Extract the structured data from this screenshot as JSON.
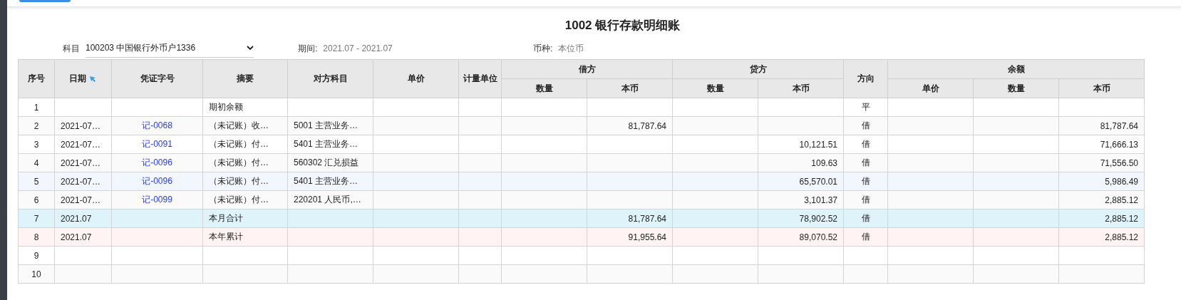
{
  "top_button": {
    "visible": true
  },
  "title": "1002 银行存款明细账",
  "filters": [
    {
      "kind": "select",
      "label": "科目",
      "value": "100203 中国银行外币户1336"
    },
    {
      "kind": "text",
      "label": "期间:",
      "value": "2021.07 - 2021.07"
    },
    {
      "kind": "text",
      "label": "币种:",
      "value": "本位币"
    }
  ],
  "table": {
    "header_rows": [
      [
        {
          "label": "序号",
          "rowspan": 2,
          "sortable": false
        },
        {
          "label": "日期",
          "rowspan": 2,
          "sortable": true
        },
        {
          "label": "凭证字号",
          "rowspan": 2,
          "sortable": false
        },
        {
          "label": "摘要",
          "rowspan": 2,
          "sortable": false
        },
        {
          "label": "对方科目",
          "rowspan": 2,
          "sortable": false
        },
        {
          "label": "单价",
          "rowspan": 2,
          "sortable": false
        },
        {
          "label": "计量单位",
          "rowspan": 2,
          "sortable": false
        },
        {
          "label": "借方",
          "colspan": 2,
          "sortable": false
        },
        {
          "label": "贷方",
          "colspan": 2,
          "sortable": false
        },
        {
          "label": "方向",
          "rowspan": 2,
          "sortable": false
        },
        {
          "label": "余额",
          "colspan": 3,
          "sortable": false
        }
      ],
      [
        {
          "label": "数量",
          "sortable": false
        },
        {
          "label": "本币",
          "sortable": false
        },
        {
          "label": "数量",
          "sortable": false
        },
        {
          "label": "本币",
          "sortable": false
        },
        {
          "label": "单价",
          "sortable": false
        },
        {
          "label": "数量",
          "sortable": false
        },
        {
          "label": "本币",
          "sortable": false
        }
      ]
    ],
    "rows": [
      {
        "kind": "normal",
        "selected": false,
        "cells": [
          "1",
          "",
          "",
          "期初余额",
          "",
          "",
          "",
          "",
          "",
          "",
          "",
          "平",
          "",
          "",
          ""
        ]
      },
      {
        "kind": "normal",
        "selected": false,
        "cells": [
          "2",
          "2021-07…",
          "记-0068",
          "（未记账）收…",
          "5001 主营业务…",
          "",
          "",
          "",
          "81,787.64",
          "",
          "",
          "借",
          "",
          "",
          "81,787.64"
        ]
      },
      {
        "kind": "normal",
        "selected": false,
        "cells": [
          "3",
          "2021-07…",
          "记-0091",
          "（未记账）付…",
          "5401 主营业务…",
          "",
          "",
          "",
          "",
          "",
          "10,121.51",
          "借",
          "",
          "",
          "71,666.13"
        ]
      },
      {
        "kind": "normal",
        "selected": false,
        "cells": [
          "4",
          "2021-07…",
          "记-0096",
          "（未记账）付…",
          "560302 汇兑损益",
          "",
          "",
          "",
          "",
          "",
          "109.63",
          "借",
          "",
          "",
          "71,556.50"
        ]
      },
      {
        "kind": "normal",
        "selected": true,
        "cells": [
          "5",
          "2021-07…",
          "记-0096",
          "（未记账）付…",
          "5401 主营业务…",
          "",
          "",
          "",
          "",
          "",
          "65,570.01",
          "借",
          "",
          "",
          "5,986.49"
        ]
      },
      {
        "kind": "normal",
        "selected": false,
        "cells": [
          "6",
          "2021-07…",
          "记-0099",
          "（未记账）付…",
          "220201 人民币,…",
          "",
          "",
          "",
          "",
          "",
          "3,101.37",
          "借",
          "",
          "",
          "2,885.12"
        ]
      },
      {
        "kind": "month_total",
        "selected": false,
        "cells": [
          "7",
          "2021.07",
          "",
          "本月合计",
          "",
          "",
          "",
          "",
          "81,787.64",
          "",
          "78,902.52",
          "借",
          "",
          "",
          "2,885.12"
        ]
      },
      {
        "kind": "year_total",
        "selected": false,
        "cells": [
          "8",
          "2021.07",
          "",
          "本年累计",
          "",
          "",
          "",
          "",
          "91,955.64",
          "",
          "89,070.52",
          "借",
          "",
          "",
          "2,885.12"
        ]
      },
      {
        "kind": "normal",
        "selected": false,
        "cells": [
          "9",
          "",
          "",
          "",
          "",
          "",
          "",
          "",
          "",
          "",
          "",
          "",
          "",
          "",
          ""
        ]
      },
      {
        "kind": "normal",
        "selected": false,
        "cells": [
          "10",
          "",
          "",
          "",
          "",
          "",
          "",
          "",
          "",
          "",
          "",
          "",
          "",
          "",
          ""
        ]
      }
    ]
  }
}
